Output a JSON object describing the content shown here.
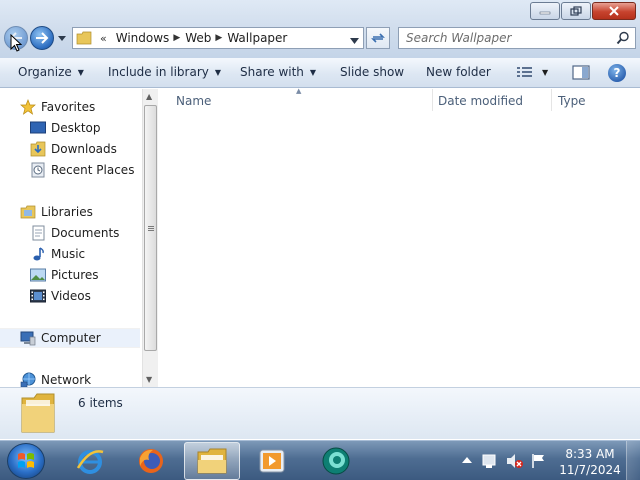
{
  "window": {
    "minimize_icon": "minimize-icon",
    "maximize_icon": "restore-icon",
    "close_icon": "close-icon"
  },
  "address": {
    "overflow": "«",
    "crumbs": [
      "Windows",
      "Web",
      "Wallpaper"
    ]
  },
  "search": {
    "placeholder": "Search Wallpaper"
  },
  "toolbar": {
    "organize": "Organize",
    "include_in_library": "Include in library",
    "share_with": "Share with",
    "slide_show": "Slide show",
    "new_folder": "New folder"
  },
  "nav": {
    "favorites": "Favorites",
    "desktop": "Desktop",
    "downloads": "Downloads",
    "recent_places": "Recent Places",
    "libraries": "Libraries",
    "documents": "Documents",
    "music": "Music",
    "pictures": "Pictures",
    "videos": "Videos",
    "computer": "Computer",
    "network": "Network"
  },
  "columns": {
    "name": "Name",
    "date_modified": "Date modified",
    "type": "Type"
  },
  "details": {
    "items": "6 items"
  },
  "taskbar": {
    "apps": [
      "internet-explorer",
      "firefox",
      "windows-explorer",
      "media-player",
      "network-app"
    ],
    "active_app": "windows-explorer"
  },
  "clock": {
    "time": "8:33 AM",
    "date": "11/7/2024"
  },
  "colors": {
    "accent": "#2b6cc0",
    "taskbar": "#4e6d92",
    "close": "#c7432e"
  }
}
